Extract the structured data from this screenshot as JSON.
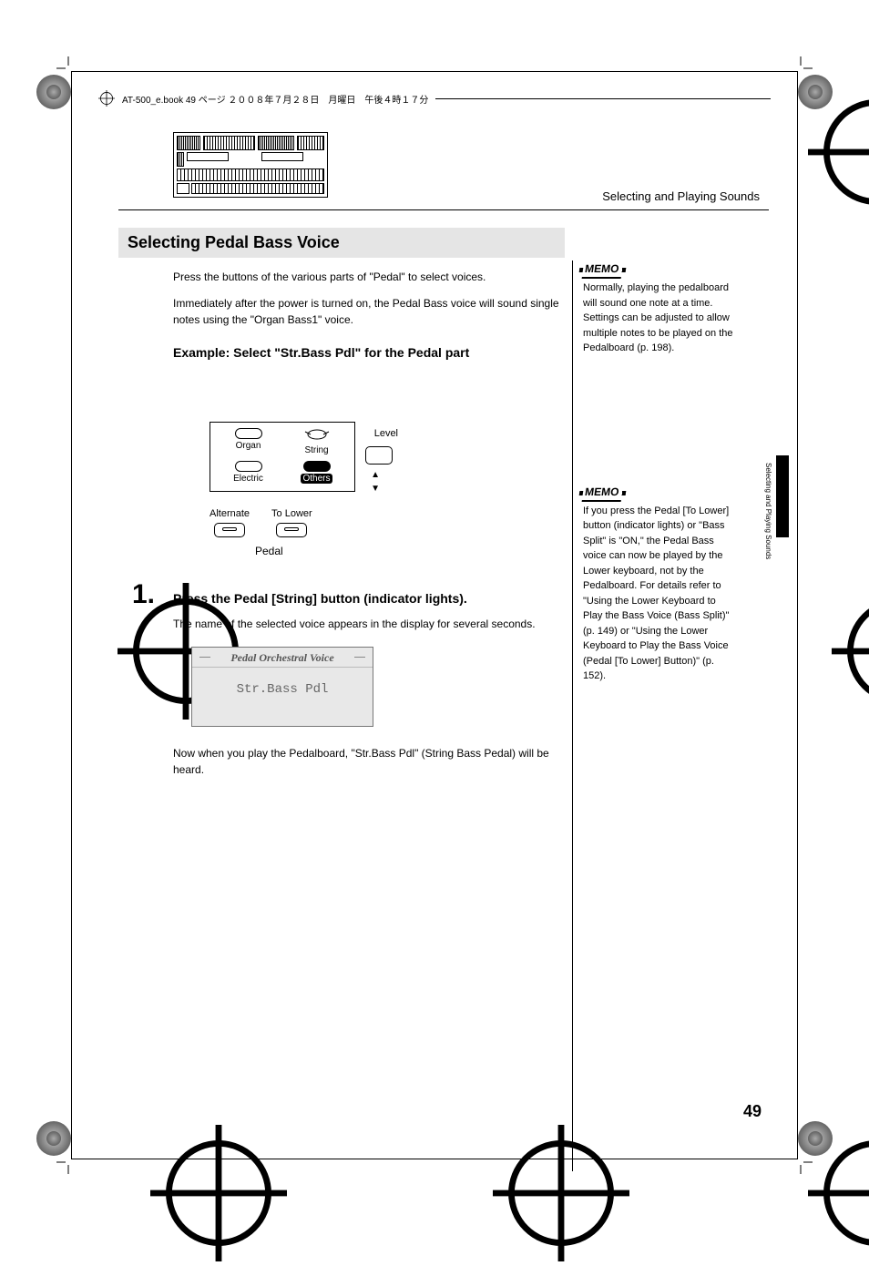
{
  "book_header": "AT-500_e.book  49 ページ  ２００８年７月２８日　月曜日　午後４時１７分",
  "breadcrumb": "Selecting and Playing Sounds",
  "section_title": "Selecting Pedal Bass Voice",
  "para1": "Press the buttons of the various parts of \"Pedal\" to select voices.",
  "para2": "Immediately after the power is turned on, the Pedal Bass voice will sound single notes using the \"Organ Bass1\" voice.",
  "example_label": "Example: Select \"Str.Bass Pdl\" for the Pedal part",
  "diagram": {
    "big_num": "1",
    "buttons": {
      "organ": "Organ",
      "string": "String",
      "electric": "Electric",
      "others": "Others"
    },
    "level_label": "Level",
    "lower": {
      "alternate": "Alternate",
      "to_lower": "To Lower",
      "pedal": "Pedal"
    }
  },
  "step": {
    "num": "1.",
    "title": "Press the Pedal [String] button (indicator lights).",
    "body": "The name of the selected voice appears in the display for several seconds.",
    "display_header": "Pedal Orchestral Voice",
    "display_value": "Str.Bass Pdl",
    "after": "Now when you play the Pedalboard, \"Str.Bass Pdl\" (String Bass Pedal) will be heard."
  },
  "memo1": {
    "label": "MEMO",
    "text": "Normally, playing the pedalboard will sound one note at a time. Settings can be adjusted to allow multiple notes to be played on the Pedalboard (p. 198)."
  },
  "memo2": {
    "label": "MEMO",
    "text": "If you press the Pedal [To Lower] button (indicator lights) or \"Bass Split\" is \"ON,\" the Pedal Bass voice can now be played by the Lower keyboard, not by the Pedalboard. For details refer to \"Using the Lower Keyboard to Play the Bass Voice (Bass Split)\" (p. 149) or \"Using the Lower Keyboard to Play the Bass Voice (Pedal [To Lower] Button)\" (p. 152)."
  },
  "side_vertical": "Selecting and Playing Sounds",
  "page_number": "49"
}
